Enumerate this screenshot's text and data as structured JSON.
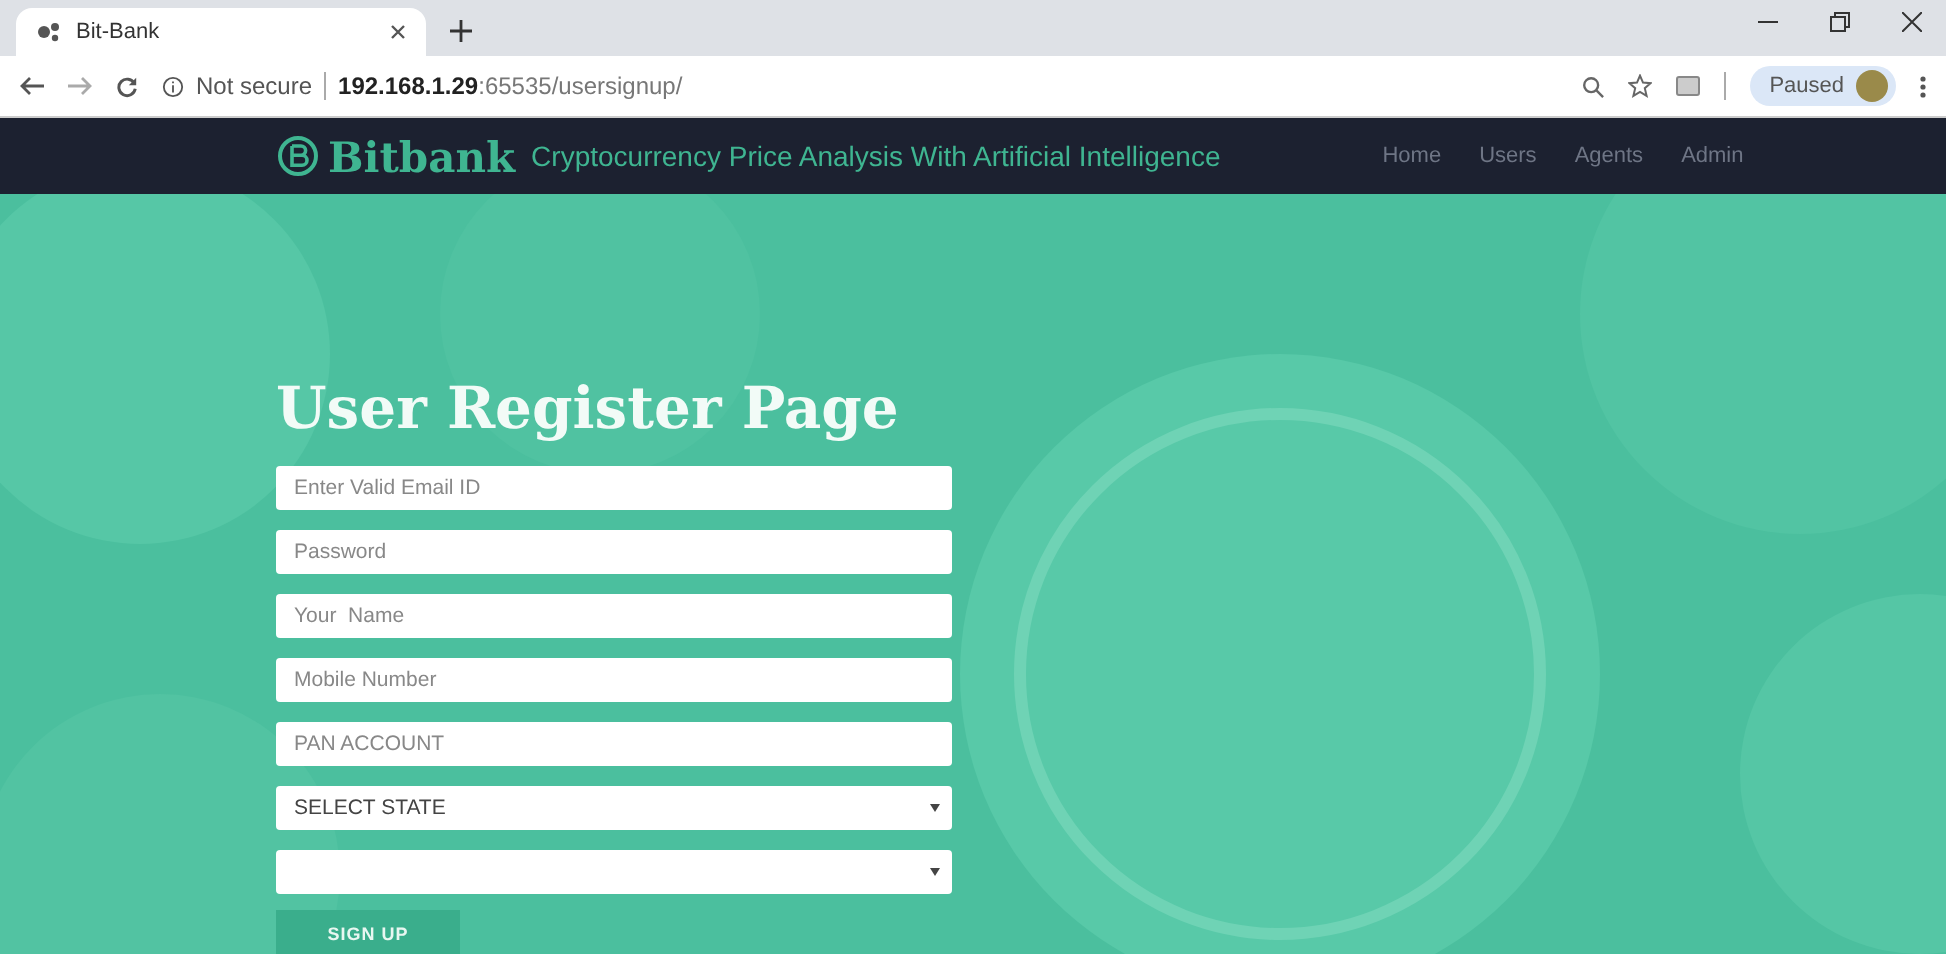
{
  "browser": {
    "tab_title": "Bit-Bank",
    "address_security": "Not secure",
    "address": "**192.168.1.29**:65535/usersignup/",
    "profile_label": "Paused"
  },
  "navbar": {
    "brand": "Bitbank",
    "tagline": "Cryptocurrency Price Analysis With Artificial Intelligence",
    "links": [
      "Home",
      "Users",
      "Agents",
      "Admin"
    ]
  },
  "form": {
    "title": "User Register Page",
    "fields": [
      {
        "kind": "text",
        "placeholder": "Enter Valid Email ID"
      },
      {
        "kind": "text",
        "placeholder": "Password"
      },
      {
        "kind": "text",
        "placeholder": "Your  Name"
      },
      {
        "kind": "text",
        "placeholder": "Mobile Number"
      },
      {
        "kind": "text",
        "placeholder": "PAN ACCOUNT"
      },
      {
        "kind": "select",
        "value": "SELECT STATE"
      },
      {
        "kind": "select"
      }
    ],
    "submit": "SIGN UP"
  }
}
